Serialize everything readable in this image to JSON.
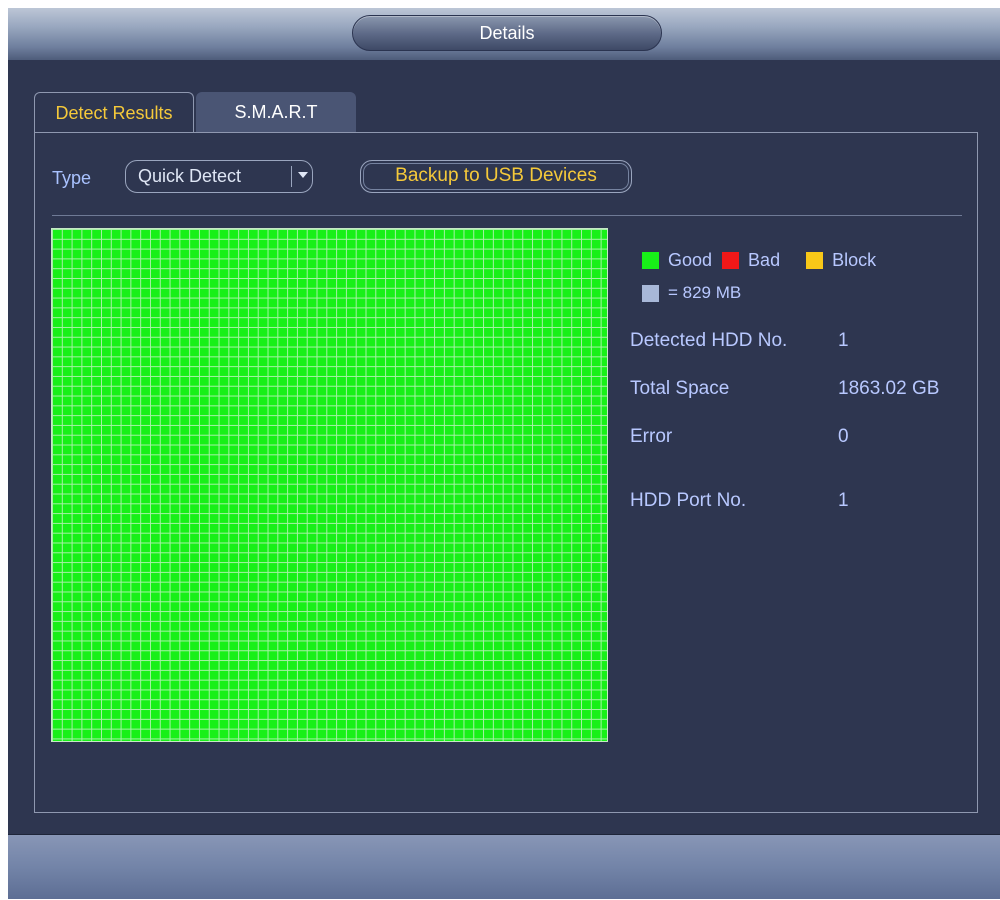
{
  "window": {
    "title": "Details"
  },
  "tabs": [
    {
      "label": "Detect Results",
      "active": true
    },
    {
      "label": "S.M.A.R.T",
      "active": false
    }
  ],
  "toolbar": {
    "type_label": "Type",
    "type_value": "Quick Detect",
    "backup_label": "Backup to USB Devices"
  },
  "legend": {
    "good": "Good",
    "bad": "Bad",
    "block": "Block",
    "unit": "= 829 MB",
    "colors": {
      "good": "#18f018",
      "bad": "#f01818",
      "block": "#f8c818",
      "unit": "#a8b8d8"
    }
  },
  "info": {
    "detected_hdd_label": "Detected HDD No.",
    "detected_hdd_value": "1",
    "total_space_label": "Total Space",
    "total_space_value": "1863.02 GB",
    "error_label": "Error",
    "error_value": "0",
    "port_label": "HDD Port No.",
    "port_value": "1"
  },
  "colors": {
    "accent": "#f5c93a",
    "label": "#b8c8ff",
    "background": "#2e3650"
  }
}
